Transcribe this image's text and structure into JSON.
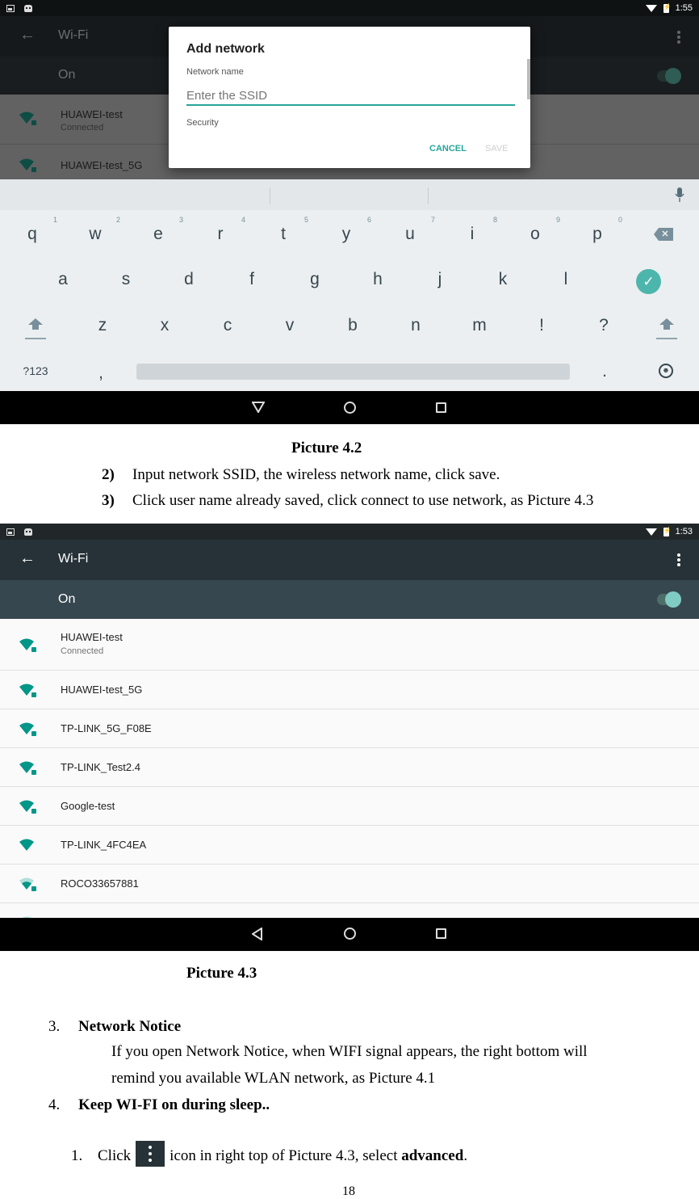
{
  "picture_4_2": {
    "status_bar": {
      "time": "1:55",
      "left_icons": [
        "image-icon",
        "android-icon"
      ],
      "right_icons": [
        "wifi-icon",
        "battery-charging-icon"
      ]
    },
    "app_bar": {
      "back_icon": "arrow-left-icon",
      "title": "Wi-Fi",
      "menu_icon": "more-vert-icon"
    },
    "wifi_toggle": {
      "label": "On",
      "state": "on"
    },
    "networks": [
      {
        "name": "HUAWEI-test",
        "status": "Connected",
        "secured": true,
        "signal": 4
      },
      {
        "name": "HUAWEI-test_5G",
        "status": "",
        "secured": true,
        "signal": 4
      }
    ],
    "dialog": {
      "title": "Add network",
      "network_name_label": "Network name",
      "ssid_placeholder": "Enter the SSID",
      "ssid_value": "",
      "security_label": "Security",
      "cancel_label": "CANCEL",
      "save_label": "SAVE",
      "save_enabled": false
    },
    "keyboard": {
      "row1": [
        "q",
        "w",
        "e",
        "r",
        "t",
        "y",
        "u",
        "i",
        "o",
        "p"
      ],
      "row1_hints": [
        "1",
        "2",
        "3",
        "4",
        "5",
        "6",
        "7",
        "8",
        "9",
        "0"
      ],
      "row2": [
        "a",
        "s",
        "d",
        "f",
        "g",
        "h",
        "j",
        "k",
        "l"
      ],
      "row3": [
        "z",
        "x",
        "c",
        "v",
        "b",
        "n",
        "m",
        "!",
        "?"
      ],
      "symbols_key": "?123",
      "comma": ",",
      "period": ".",
      "enter_glyph": "✓",
      "backspace_glyph": "✕",
      "emoji_glyph": "☻"
    },
    "nav": {
      "back": "back-icon",
      "home": "home-icon",
      "recents": "recents-icon"
    }
  },
  "caption_4_2": "Picture 4.2",
  "steps_a": [
    {
      "num": "2)",
      "text": "Input network SSID, the wireless network name, click save."
    },
    {
      "num": "3)",
      "text": "Click user name already saved, click connect to use network, as Picture 4.3"
    }
  ],
  "picture_4_3": {
    "status_bar": {
      "time": "1:53"
    },
    "app_bar": {
      "title": "Wi-Fi"
    },
    "wifi_toggle": {
      "label": "On",
      "state": "on"
    },
    "networks": [
      {
        "name": "HUAWEI-test",
        "status": "Connected",
        "secured": true,
        "signal": 4
      },
      {
        "name": "HUAWEI-test_5G",
        "status": "",
        "secured": true,
        "signal": 4
      },
      {
        "name": "TP-LINK_5G_F08E",
        "status": "",
        "secured": true,
        "signal": 4
      },
      {
        "name": "TP-LINK_Test2.4",
        "status": "",
        "secured": true,
        "signal": 4
      },
      {
        "name": "Google-test",
        "status": "",
        "secured": true,
        "signal": 4
      },
      {
        "name": "TP-LINK_4FC4EA",
        "status": "",
        "secured": false,
        "signal": 4
      },
      {
        "name": "ROCO33657881",
        "status": "",
        "secured": true,
        "signal": 3
      }
    ]
  },
  "caption_4_3": "Picture 4.3",
  "section3": {
    "num": "3.",
    "title": "Network Notice",
    "body_line1": "If you open Network Notice, when WIFI signal appears, the right bottom will",
    "body_line2": "remind you available WLAN network, as Picture 4.1"
  },
  "section4": {
    "num": "4.",
    "title": "Keep WI-FI on during sleep..",
    "step_num": "1.",
    "step_pre": "Click",
    "step_mid": "icon in right top of Picture 4.3, select",
    "step_bold": "advanced",
    "step_end": "."
  },
  "page_number": "18",
  "colors": {
    "accent": "#26a69a",
    "appbar": "#263238",
    "onbar": "#37474f",
    "wifi_icon": "#009688"
  }
}
